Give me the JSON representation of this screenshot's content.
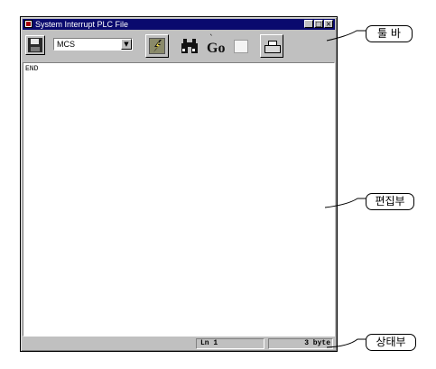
{
  "window": {
    "title": "System Interrupt PLC File",
    "controls": {
      "minimize": "_",
      "maximize": "□",
      "close": "×"
    }
  },
  "toolbar": {
    "program_select": "MCS",
    "buttons": [
      {
        "name": "save",
        "icon": "floppy-disk-icon"
      },
      {
        "name": "plc-connect",
        "icon": "lightning-icon"
      },
      {
        "name": "find",
        "icon": "binoculars-icon"
      },
      {
        "name": "go",
        "icon": "go-icon",
        "text": "Go"
      },
      {
        "name": "document",
        "icon": "document-icon"
      },
      {
        "name": "print",
        "icon": "printer-icon"
      }
    ]
  },
  "editor": {
    "content": "END"
  },
  "statusbar": {
    "line": "Ln 1",
    "size": "3 byte"
  },
  "callouts": {
    "toolbar": "툴 바",
    "editor": "편집부",
    "statusbar": "상태부"
  }
}
